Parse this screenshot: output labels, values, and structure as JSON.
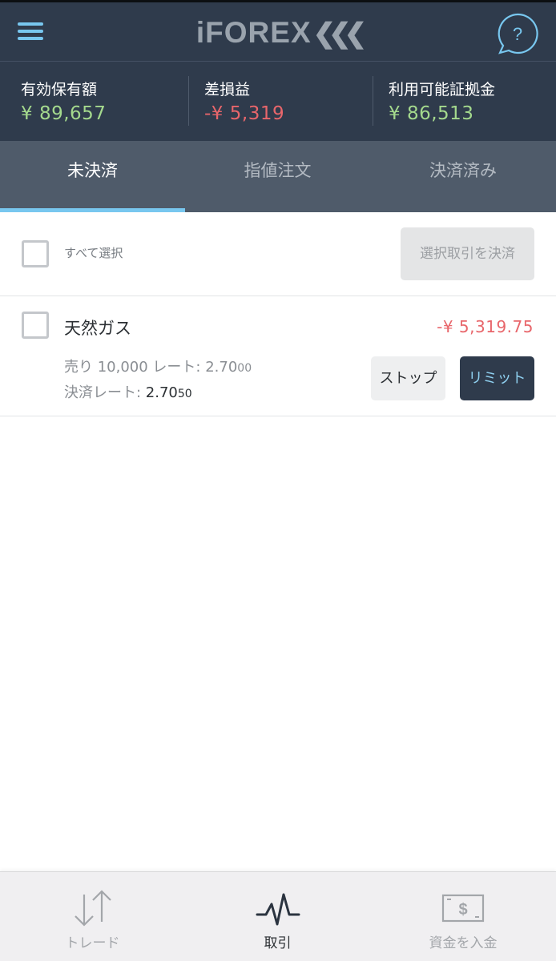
{
  "header": {
    "logo_text": "iFOREX",
    "logo_mark": "❮❮❮",
    "menu_icon": "hamburger-menu-icon",
    "help_icon": "question-chat-icon",
    "help_symbol": "?"
  },
  "summary": {
    "equity": {
      "label": "有効保有額",
      "value": "¥ 89,657"
    },
    "pnl": {
      "label": "差損益",
      "value": "-¥ 5,319"
    },
    "available_margin": {
      "label": "利用可能証拠金",
      "value": "¥ 86,513"
    }
  },
  "tabs": [
    {
      "label": "未決済",
      "active": true
    },
    {
      "label": "指値注文",
      "active": false
    },
    {
      "label": "決済済み",
      "active": false
    }
  ],
  "select_row": {
    "select_all_label": "すべて選択",
    "close_selected_label": "選択取引を決済"
  },
  "positions": [
    {
      "instrument": "天然ガス",
      "pnl": "-¥ 5,319.75",
      "trade_prefix": "売り 10,000 レート: ",
      "trade_rate_main": "2.70",
      "trade_rate_small": "00",
      "close_prefix": "決済レート: ",
      "close_rate_main": "2.70",
      "close_rate_small": "50",
      "stop_label": "ストップ",
      "limit_label": "リミット"
    }
  ],
  "bottom_nav": [
    {
      "label": "トレード",
      "icon": "up-down-arrows-icon",
      "active": false
    },
    {
      "label": "取引",
      "icon": "pulse-line-icon",
      "active": true
    },
    {
      "label": "資金を入金",
      "icon": "dollar-bill-icon",
      "active": false
    }
  ],
  "colors": {
    "header_bg": "#2f3b4c",
    "tabs_bg": "#4f5b6a",
    "accent_blue": "#78c7ef",
    "positive_green": "#a4d98d",
    "negative_red": "#e8666b"
  }
}
